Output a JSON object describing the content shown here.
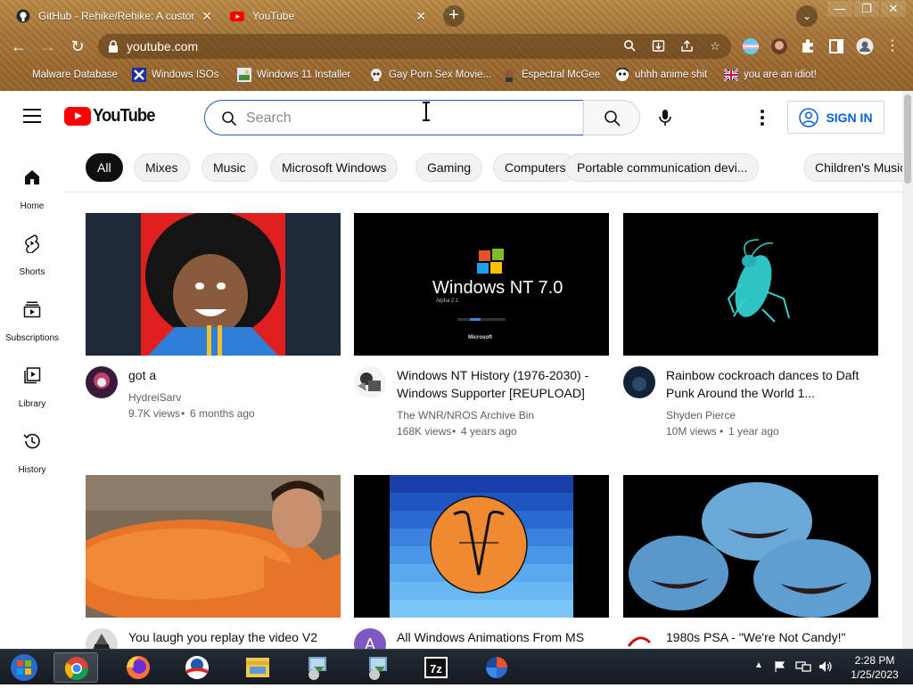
{
  "browser": {
    "tabs": [
      {
        "title": "GitHub - Rehike/Rehike: A custom",
        "icon": "github-icon"
      },
      {
        "title": "YouTube",
        "icon": "youtube-favicon"
      }
    ],
    "url": "youtube.com",
    "bookmarks": [
      {
        "label": "Malware Database"
      },
      {
        "label": "Windows ISOs"
      },
      {
        "label": "Windows 11 Installer"
      },
      {
        "label": "Gay Porn Sex Movie..."
      },
      {
        "label": "Espectral McGee"
      },
      {
        "label": "uhhh anime shit"
      },
      {
        "label": "you are an idiot!"
      }
    ]
  },
  "youtube": {
    "logo_text": "YouTube",
    "search_placeholder": "Search",
    "signin_label": "SIGN IN",
    "guide": [
      {
        "label": "Home",
        "icon": "home-icon"
      },
      {
        "label": "Shorts",
        "icon": "shorts-icon"
      },
      {
        "label": "Subscriptions",
        "icon": "subscriptions-icon"
      },
      {
        "label": "Library",
        "icon": "library-icon"
      },
      {
        "label": "History",
        "icon": "history-icon"
      }
    ],
    "chips": [
      "All",
      "Mixes",
      "Music",
      "Microsoft Windows",
      "Gaming",
      "Computers",
      "Portable communication devi...",
      "Children's Music"
    ],
    "videos": [
      {
        "title": "got a",
        "channel": "HydreiSarv",
        "views": "9.7K views",
        "age": "6 months ago"
      },
      {
        "title": "Windows NT History (1976-2030) - Windows Supporter [REUPLOAD]",
        "channel": "The WNR/NROS Archive Bin",
        "views": "168K views",
        "age": "4 years ago"
      },
      {
        "title": "Rainbow cockroach dances to Daft Punk Around the World 1...",
        "channel": "Shyden Pierce",
        "views": "10M views",
        "age": "1 year ago"
      },
      {
        "title": "You laugh you replay the video V2",
        "channel": "",
        "views": "",
        "age": ""
      },
      {
        "title": "All Windows Animations From MS",
        "channel": "",
        "views": "",
        "age": "",
        "avatar_letter": "A"
      },
      {
        "title": "1980s PSA - \"We're Not Candy!\"",
        "channel": "",
        "views": "",
        "age": ""
      }
    ],
    "thumb_texts": {
      "nt_brand": "Windows NT 7.0",
      "nt_ms": "Microsoft",
      "nt_alpha": "Alpha 2.1"
    }
  },
  "taskbar": {
    "apps": [
      "start-orb",
      "chrome",
      "firefox",
      "obama-icon",
      "file-explorer",
      "installer-1",
      "installer-2",
      "7zip",
      "app-icon"
    ],
    "time": "2:28 PM",
    "date": "1/25/2023"
  }
}
